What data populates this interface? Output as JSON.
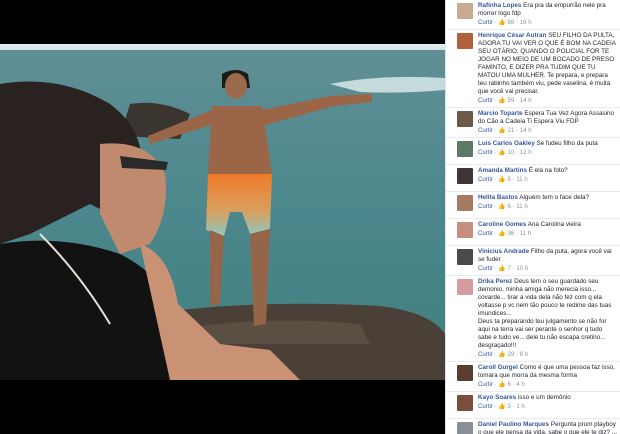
{
  "comments": [
    {
      "author": "Rafinha Lopes",
      "text": "Era pra da empurrão nele pra morrer logo fdp",
      "like_label": "Curtir",
      "likes": "68",
      "time": "16 h",
      "avatar_color": "#c9a98f"
    },
    {
      "author": "Henrique César Autran",
      "text": "SEU FILHO DA PULTA, AGORA TU VAI VER O QUE É BOM NA CADEIA SEU OTÁRIO, QUANDO O POLICIAL FOR TE JOGAR NO MEIO DE UM BOCADO DE PRESO FAMINTO, E DIZER PRA TUDIM QUE TU MATOU UMA MULHER. Te prepara, e prepara teu rabinho também viu, pede vaselina, é muita que você vai precisar.",
      "like_label": "Curtir",
      "likes": "59",
      "time": "14 h",
      "avatar_color": "#b0623a"
    },
    {
      "author": "Marcio Toparte",
      "text": "Espera Tua Vez Agora Assasino do Cão a Cadeia Ti Espera Viu FDP",
      "like_label": "Curtir",
      "likes": "21",
      "time": "14 h",
      "avatar_color": "#6b5a4a"
    },
    {
      "author": "Luis Carlos Oakley",
      "text": "Se fudeu filho da puta",
      "like_label": "Curtir",
      "likes": "10",
      "time": "12 h",
      "avatar_color": "#5c7a63"
    },
    {
      "author": "Amanda Martins",
      "text": "É ela na foto?",
      "like_label": "Curtir",
      "likes": "8",
      "time": "11 h",
      "avatar_color": "#3f3438"
    },
    {
      "author": "Helita Bastos",
      "text": "Alguém tem o face dela?",
      "like_label": "Curtir",
      "likes": "6",
      "time": "11 h",
      "avatar_color": "#a77b63"
    },
    {
      "author": "Caroline Gomes",
      "text": "Ana Carolina vieira",
      "like_label": "Curtir",
      "likes": "36",
      "time": "11 h",
      "avatar_color": "#c78f7f"
    },
    {
      "author": "Vinicius Andrade",
      "text": "Filho da puta, agora você vai se fuder",
      "like_label": "Curtir",
      "likes": "7",
      "time": "10 h",
      "avatar_color": "#4a4a4a"
    },
    {
      "author": "Drika Perez",
      "text": "Deus tem o seu guardado seu demonio, minha amiga não merecia isso... covarde... tirar a vida dela não fez com q ela voltasse p vc nem tão pouco te redime das tuas imundices...\nDeus ta preparando teu julgamento se não for aqui na terra vai ser perante o senhor q tudo sabe e tudo ve... dele tu não escapa cretino... desgraçado!!!",
      "like_label": "Curtir",
      "likes": "29",
      "time": "8 h",
      "avatar_color": "#d79aa0"
    },
    {
      "author": "Caroll Gurgel",
      "text": "Como é que uma pessoa faz isso, tomara que morra da mesma forma",
      "like_label": "Curtir",
      "likes": "6",
      "time": "4 h",
      "avatar_color": "#5a3e2e"
    },
    {
      "author": "Kayo Soares",
      "text": "isso e um demônio",
      "like_label": "Curtir",
      "likes": "3",
      "time": "1 h",
      "avatar_color": "#7a4e3a"
    },
    {
      "author": "Daniel Paulino Marques",
      "text": "Pergunta prum playboy o que ele pensa da vida, sabe o que ele te diz? ... Se fosse todo",
      "like_label": "Curtir",
      "likes": "",
      "time": "",
      "avatar_color": "#8a8f95"
    }
  ]
}
